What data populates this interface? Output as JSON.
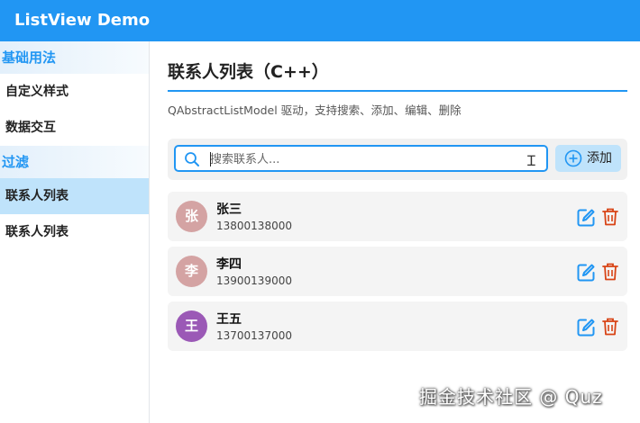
{
  "app": {
    "title": "ListView Demo",
    "accent": "#2196f3"
  },
  "sidebar": {
    "sections": [
      {
        "label": "基础用法",
        "items": [
          {
            "label": "自定义样式"
          },
          {
            "label": "数据交互"
          }
        ]
      },
      {
        "label": "过滤",
        "items": [
          {
            "label": "联系人列表",
            "active": true
          },
          {
            "label": "联系人列表"
          }
        ]
      }
    ]
  },
  "page": {
    "title": "联系人列表（C++）",
    "subtitle": "QAbstractListModel 驱动，支持搜索、添加、编辑、删除"
  },
  "toolbar": {
    "search_placeholder": "搜索联系人...",
    "search_icon": "search-icon",
    "add_label": "添加",
    "add_icon": "plus-circle-icon"
  },
  "contacts": [
    {
      "initial": "张",
      "name": "张三",
      "phone": "13800138000",
      "avatar_color": "#d4a3a3"
    },
    {
      "initial": "李",
      "name": "李四",
      "phone": "13900139000",
      "avatar_color": "#d4a3a3"
    },
    {
      "initial": "王",
      "name": "王五",
      "phone": "13700137000",
      "avatar_color": "#9b59b6"
    }
  ],
  "actions": {
    "edit_icon": "edit-icon",
    "delete_icon": "trash-icon",
    "edit_color": "#2196f3",
    "delete_color": "#d84315"
  },
  "watermark": "掘金技术社区 @ Quz"
}
